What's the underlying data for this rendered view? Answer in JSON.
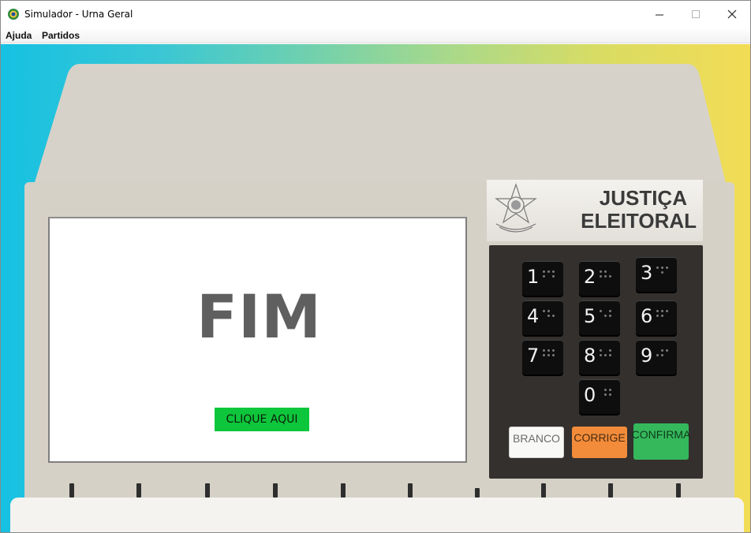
{
  "window": {
    "title": "Simulador - Urna Geral"
  },
  "menu": {
    "items": [
      "Ajuda",
      "Partidos"
    ]
  },
  "screen": {
    "message": "FIM",
    "button_label": "CLIQUE AQUI"
  },
  "plate": {
    "line1": "JUSTIÇA",
    "line2": "ELEITORAL"
  },
  "keypad": {
    "digits": [
      "1",
      "2",
      "3",
      "4",
      "5",
      "6",
      "7",
      "8",
      "9",
      "0"
    ],
    "branco": "BRANCO",
    "corrige": "CORRIGE",
    "confirma": "CONFIRMA"
  },
  "colors": {
    "background_start": "#16c1e2",
    "background_end": "#f3dc55",
    "urn_body": "#d6d1c7",
    "screen_button": "#0ec63b",
    "branco": "#f8f8f6",
    "corrige": "#f28c3a",
    "confirma": "#35b85b"
  }
}
